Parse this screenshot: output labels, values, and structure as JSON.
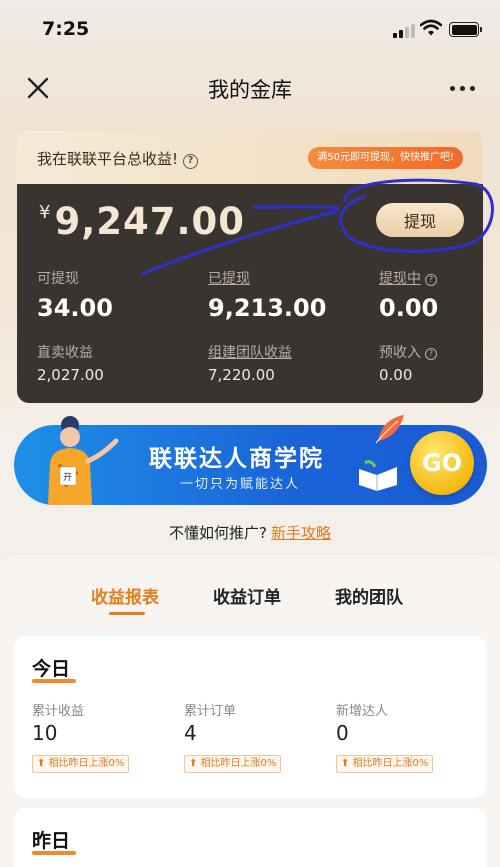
{
  "status_bar": {
    "time": "7:25"
  },
  "nav": {
    "title": "我的金库"
  },
  "earnings": {
    "label": "我在联联平台总收益!",
    "promo": "满50元即可提现，快快推广吧!",
    "currency": "¥",
    "balance": "9,247.00",
    "withdraw_button": "提现",
    "stats": [
      {
        "label": "可提现",
        "value": "34.00"
      },
      {
        "label": "已提现",
        "value": "9,213.00"
      },
      {
        "label": "提现中",
        "value": "0.00"
      }
    ],
    "substats": [
      {
        "label": "直卖收益",
        "value": "2,027.00"
      },
      {
        "label": "组建团队收益",
        "value": "7,220.00"
      },
      {
        "label": "预收入",
        "value": "0.00"
      }
    ]
  },
  "banner": {
    "title": "联联达人商学院",
    "subtitle": "一切只为赋能达人",
    "go_label": "GO",
    "person_sign": "开"
  },
  "guide": {
    "text": "不懂如何推广?",
    "link": "新手攻略"
  },
  "tabs": [
    {
      "label": "收益报表",
      "active": true
    },
    {
      "label": "收益订单",
      "active": false
    },
    {
      "label": "我的团队",
      "active": false
    }
  ],
  "today": {
    "title": "今日",
    "metrics": [
      {
        "label": "累计收益",
        "value": "10",
        "compare": "相比昨日上涨0%"
      },
      {
        "label": "累计订单",
        "value": "4",
        "compare": "相比昨日上涨0%"
      },
      {
        "label": "新增达人",
        "value": "0",
        "compare": "相比昨日上涨0%"
      }
    ]
  },
  "yesterday": {
    "title": "昨日"
  },
  "colors": {
    "accent": "#e77e1c",
    "card_dark": "#3a3431",
    "banner_blue": "#1a63d8",
    "annotation": "#2f2fcf"
  }
}
